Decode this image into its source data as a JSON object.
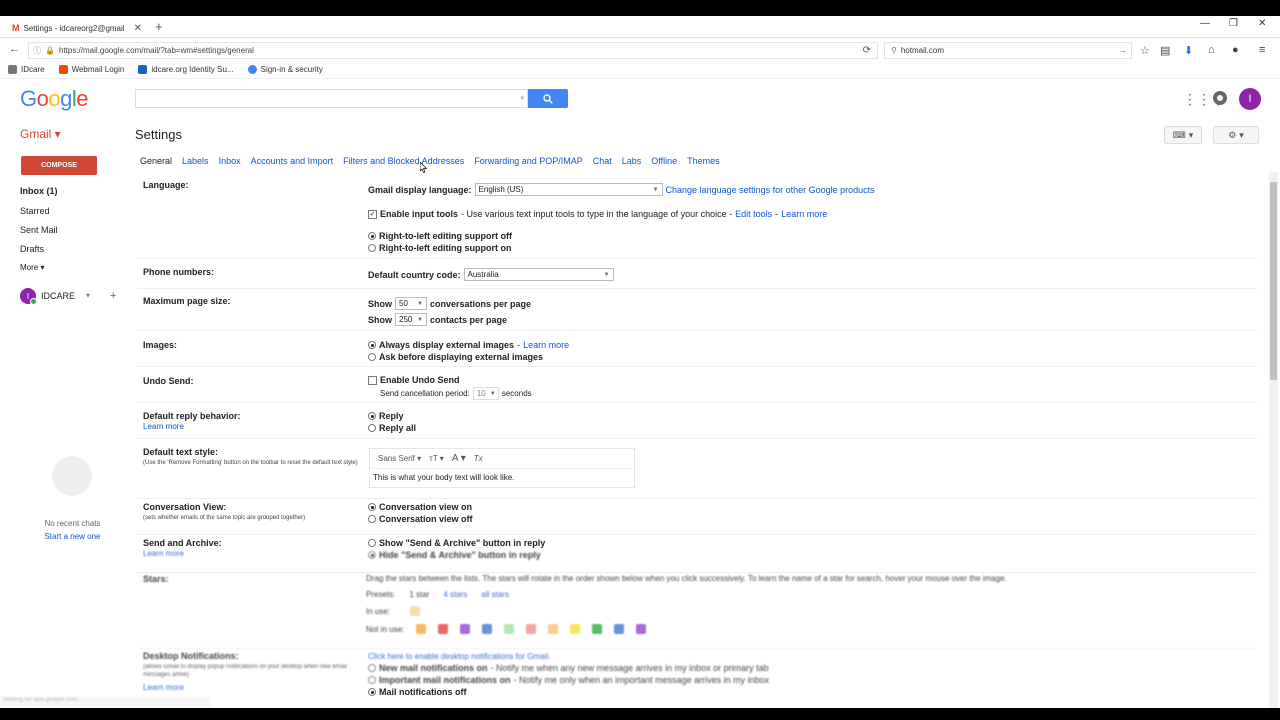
{
  "browser": {
    "tab_title": "Settings - idcareorg2@gmail",
    "url": "https://mail.google.com/mail/?tab=wm#settings/general",
    "search_value": "hotmail.com",
    "bookmarks": [
      {
        "label": "IDcare"
      },
      {
        "label": "Webmail Login"
      },
      {
        "label": "idcare.org Identity Su..."
      },
      {
        "label": "Sign-in & security"
      }
    ]
  },
  "header": {
    "logo": [
      "G",
      "o",
      "o",
      "g",
      "l",
      "e"
    ],
    "avatar_letter": "I"
  },
  "gmail": {
    "label": "Gmail ▾",
    "page_title": "Settings",
    "compose": "COMPOSE",
    "nav": [
      {
        "label": "Inbox (1)",
        "bold": true
      },
      {
        "label": "Starred"
      },
      {
        "label": "Sent Mail"
      },
      {
        "label": "Drafts"
      },
      {
        "label": "More ▾"
      }
    ],
    "hangouts_user": "IDCARE",
    "hangouts_user_letter": "I",
    "no_chats": "No recent chats",
    "start_new": "Start a new one"
  },
  "tabs": [
    "General",
    "Labels",
    "Inbox",
    "Accounts and Import",
    "Filters and Blocked Addresses",
    "Forwarding and POP/IMAP",
    "Chat",
    "Labs",
    "Offline",
    "Themes"
  ],
  "settings": {
    "language": {
      "label": "Language:",
      "display_label": "Gmail display language:",
      "display_value": "English (US)",
      "change_link": "Change language settings for other Google products",
      "input_tools_label": "Enable input tools",
      "input_tools_desc": "- Use various text input tools to type in the language of your choice -",
      "edit_tools": "Edit tools",
      "learn_more": "Learn more",
      "rtl_off": "Right-to-left editing support off",
      "rtl_on": "Right-to-left editing support on"
    },
    "phone": {
      "label": "Phone numbers:",
      "country_label": "Default country code:",
      "country_value": "Australia"
    },
    "page_size": {
      "label": "Maximum page size:",
      "show": "Show",
      "conv_value": "50",
      "conv_text": "conversations per page",
      "contacts_value": "250",
      "contacts_text": "contacts per page"
    },
    "images": {
      "label": "Images:",
      "always": "Always display external images",
      "learn_more": "Learn more",
      "ask": "Ask before displaying external images"
    },
    "undo": {
      "label": "Undo Send:",
      "enable": "Enable Undo Send",
      "period_label": "Send cancellation period:",
      "period_value": "10",
      "seconds": "seconds"
    },
    "reply": {
      "label": "Default reply behavior:",
      "learn_more": "Learn more",
      "reply": "Reply",
      "reply_all": "Reply all"
    },
    "text_style": {
      "label": "Default text style:",
      "sub": "(Use the 'Remove Formatting' button on the toolbar to reset the default text style)",
      "font": "Sans Serif",
      "size_glyph": "тT",
      "color_glyph": "A",
      "clear_glyph": "Tx",
      "preview": "This is what your body text will look like."
    },
    "conversation": {
      "label": "Conversation View:",
      "sub": "(sets whether emails of the same topic are grouped together)",
      "on": "Conversation view on",
      "off": "Conversation view off"
    },
    "send_archive": {
      "label": "Send and Archive:",
      "learn_more": "Learn more",
      "show": "Show \"Send & Archive\" button in reply",
      "hide": "Hide \"Send & Archive\" button in reply"
    },
    "stars": {
      "label": "Stars:",
      "desc": "Drag the stars between the lists. The stars will rotate in the order shown below when you click successively. To learn the name of a star for search, hover your mouse over the image.",
      "presets": "Presets:",
      "preset_1": "1 star",
      "preset_4": "4 stars",
      "all_stars": "all stars",
      "in_use": "In use:",
      "not_in_use": "Not in use:",
      "colors": [
        "#f6ae3b",
        "#e44d4d",
        "#9c4cd7",
        "#4d7fd8",
        "#6dd16d",
        "#e44d4d",
        "#f6ae3b",
        "#f5e33b",
        "#38b349",
        "#4d7fd8",
        "#9c4cd7"
      ]
    },
    "desktop": {
      "label": "Desktop Notifications:",
      "sub": "(allows Gmail to display popup notifications on your desktop when new email messages arrive)",
      "learn_more": "Learn more",
      "enable_link": "Click here to enable desktop notifications for Gmail.",
      "new_mail": "New mail notifications on",
      "new_mail_desc": "- Notify me when any new message arrives in my inbox or primary tab",
      "important": "Important mail notifications on",
      "important_desc": "- Notify me only when an important message arrives in my inbox",
      "off": "Mail notifications off"
    }
  },
  "statusbar": "Waiting for apis.google.com..."
}
